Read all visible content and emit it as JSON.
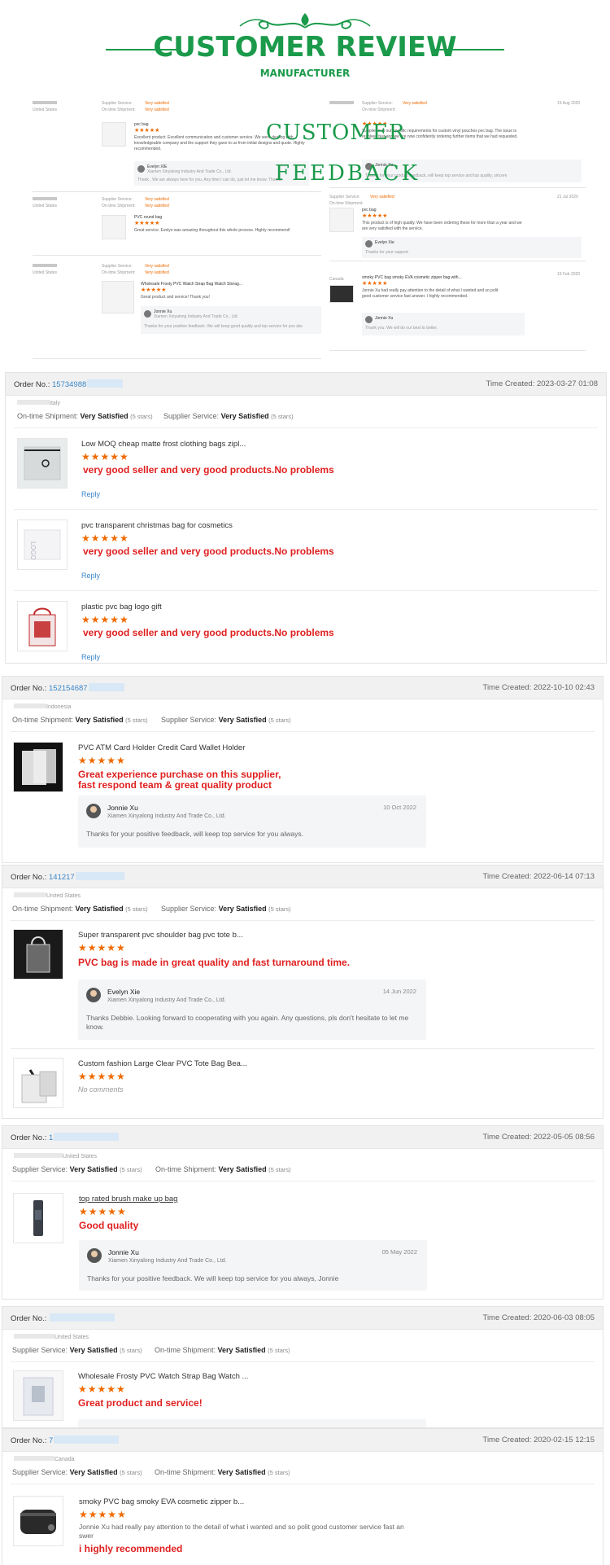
{
  "header": {
    "title": "CUSTOMER REVIEW",
    "subtitle": "MANUFACTURER",
    "accent_color": "#1a9a4a"
  },
  "collage": {
    "overlay_line1": "CUSTOMER",
    "overlay_line2": "FEEDBACK",
    "left_cards": [
      {
        "country": "United States",
        "supplier": "Supplier Service:",
        "ontime": "On-time Shipment:",
        "sat": "Very satisfied",
        "stars_label": "(5 stars)",
        "product": "pvc bag",
        "comment": "Excellent product. Excellent communication and customer service. We were dealing with knowledgeable company and the support they gave to us from initial designs and quote. Highly recommended.",
        "replier": "Evelyn XIE",
        "reply_company": "Xiamen Xinyalong Industry And Trade Co., Ltd.",
        "reply": "Thank  , We are always here for you. Any time I can do, just let me know. Thanks"
      },
      {
        "country": "United States",
        "supplier": "Supplier Service:",
        "ontime": "On-time Shipment:",
        "sat": "Very satisfied",
        "stars_label": "(5 stars)",
        "product": "PVC round bag",
        "comment": "Great service. Evelyn was amazing throughout this whole process. Highly recommend!"
      },
      {
        "country": "United States",
        "supplier": "Supplier Service:",
        "ontime": "On-time Shipment:",
        "sat": "Very satisfied",
        "stars_label": "(5 stars)",
        "product": "Wholesale Frosty PVC Watch Strap Bag Watch Storag...",
        "comment": "Great product and service! Thank you!",
        "replier": "Jonnie Xu",
        "reply_company": "Xiamen Xinyalong Industry And Trade Co., Ltd.",
        "reply": "Thanks for your positive feedback. We will keep good quality and top service for you alw"
      }
    ],
    "right_cards": [
      {
        "supplier": "Supplier Service:",
        "ontime": "On-time Shipment:",
        "sat": "Very satisfied",
        "date": "19 Aug 2020",
        "comment": "Supplier met our specific requirements for custom vinyl pouches pvc bag. The issue is resolved fast and we are now confidently ordering further items that we had requested.",
        "replier": "Jonnie Xu",
        "reply": "Thanks for your product feedback, will keep top service and top quality, sincere"
      },
      {
        "supplier": "Supplier Service:",
        "ontime": "On-time Shipment:",
        "sat": "Very satisfied",
        "date": "21 Jul 2020",
        "product": "pvc bag",
        "comment": "This product is of high quality. We have been ordering these for more than a year and we are very satisfied with the service.",
        "replier": "Evelyn Xie",
        "reply": "Thanks for your support"
      },
      {
        "country": "Canada",
        "date": "19 Feb 2020",
        "product": "smoky PVC bag smoky EVA cosmetic zipper bag with...",
        "comment": "Jonnie Xu had really pay attention to the detail of what I wanted and so polit good customer service fast answer. I highly recommended.",
        "replier": "Jonnie Xu",
        "reply": "Thank you. We will do our best to better."
      }
    ]
  },
  "orders": [
    {
      "order_label": "Order No.:",
      "order_no": "15734988",
      "time_label": "Time Created:",
      "time": "2023-03-27 01:08",
      "country": "Italy",
      "ship1_label": "On-time Shipment:",
      "ship1_value": "Very Satisfied",
      "ship1_stars": "(5 stars)",
      "ship2_label": "Supplier Service:",
      "ship2_value": "Very Satisfied",
      "ship2_stars": "(5 stars)",
      "items": [
        {
          "title": "Low MOQ cheap matte frost clothing bags zipl...",
          "stars": "★★★★★",
          "comment": "very good seller and very good products.No problems",
          "reply": "Reply"
        },
        {
          "title": "pvc transparent christmas bag for cosmetics",
          "stars": "★★★★★",
          "comment": "very good seller and very good products.No problems",
          "reply": "Reply"
        },
        {
          "title": "plastic pvc bag logo gift",
          "stars": "★★★★★",
          "comment": "very good seller and very good products.No problems",
          "reply": "Reply"
        }
      ]
    },
    {
      "order_label": "Order No.:",
      "order_no": "152154687",
      "time_label": "Time Created:",
      "time": "2022-10-10 02:43",
      "country": "Indonesia",
      "ship1_label": "On-time Shipment:",
      "ship1_value": "Very Satisfied",
      "ship1_stars": "(5 stars)",
      "ship2_label": "Supplier Service:",
      "ship2_value": "Very Satisfied",
      "ship2_stars": "(5 stars)",
      "items": [
        {
          "title": "PVC ATM Card Holder Credit Card Wallet Holder",
          "stars": "★★★★★",
          "comment_line1": "Great experience purchase on this supplier,",
          "comment_line2": "fast respond team & great quality product",
          "replier": "Jonnie Xu",
          "reply_company": "Xiamen Xinyalong Industry And Trade Co., Ltd.",
          "reply_date": "10 Oct 2022",
          "reply_text": "Thanks for your positive feedback, will keep top service for you always."
        }
      ]
    },
    {
      "order_label": "Order No.:",
      "order_no": "141217",
      "time_label": "Time Created:",
      "time": "2022-06-14 07:13",
      "country": "United States",
      "ship1_label": "On-time Shipment:",
      "ship1_value": "Very Satisfied",
      "ship1_stars": "(5 stars)",
      "ship2_label": "Supplier Service:",
      "ship2_value": "Very Satisfied",
      "ship2_stars": "(5 stars)",
      "items": [
        {
          "title": "Super transparent pvc shoulder bag pvc tote b...",
          "stars": "★★★★★",
          "comment": "PVC bag is made in great quality and fast turnaround time.",
          "replier": "Evelyn Xie",
          "reply_company": "Xiamen Xinyalong Industry And Trade Co., Ltd.",
          "reply_date": "14 Jun 2022",
          "reply_text": "Thanks Debbie. Looking forward to cooperating with you again. Any questions, pls don't hesitate to let me know."
        },
        {
          "title": "Custom fashion Large Clear PVC Tote Bag Bea...",
          "stars": "★★★★★",
          "comment": "No comments"
        }
      ]
    },
    {
      "order_label": "Order No.:",
      "order_no": "1",
      "time_label": "Time Created:",
      "time": "2022-05-05 08:56",
      "country": "United States",
      "ship1_label": "Supplier Service:",
      "ship1_value": "Very Satisfied",
      "ship1_stars": "(5 stars)",
      "ship2_label": "On-time Shipment:",
      "ship2_value": "Very Satisfied",
      "ship2_stars": "(5 stars)",
      "items": [
        {
          "title": "top rated brush make up bag",
          "stars": "★★★★★",
          "comment": "Good quality",
          "replier": "Jonnie Xu",
          "reply_company": "Xiamen Xinyalong Industry And Trade Co., Ltd.",
          "reply_date": "05 May 2022",
          "reply_text": "Thanks for your positive feedback. We will keep top service for you always, Jonnie"
        }
      ]
    },
    {
      "order_label": "Order No.:",
      "order_no": "",
      "time_label": "Time Created:",
      "time": "2020-06-03 08:05",
      "country": "United States",
      "ship1_label": "Supplier Service:",
      "ship1_value": "Very Satisfied",
      "ship1_stars": "(5 stars)",
      "ship2_label": "On-time Shipment:",
      "ship2_value": "Very Satisfied",
      "ship2_stars": "(5 stars)",
      "items": [
        {
          "title": "Wholesale Frosty PVC Watch Strap Bag Watch ...",
          "stars": "★★★★★",
          "comment": "Great product and service!"
        }
      ]
    },
    {
      "order_label": "Order No.:",
      "order_no": "7",
      "time_label": "Time Created:",
      "time": "2020-02-15 12:15",
      "country": "Canada",
      "ship1_label": "Supplier Service:",
      "ship1_value": "Very Satisfied",
      "ship1_stars": "(5 stars)",
      "ship2_label": "On-time Shipment:",
      "ship2_value": "Very Satisfied",
      "ship2_stars": "(5 stars)",
      "items": [
        {
          "title": "smoky PVC bag smoky EVA cosmetic zipper b...",
          "stars": "★★★★★",
          "comment_plain": "Jonnie Xu had really pay attention to the detail of what i wanted and so polit good customer service fast an swer",
          "comment": "i highly recommended"
        }
      ]
    }
  ]
}
